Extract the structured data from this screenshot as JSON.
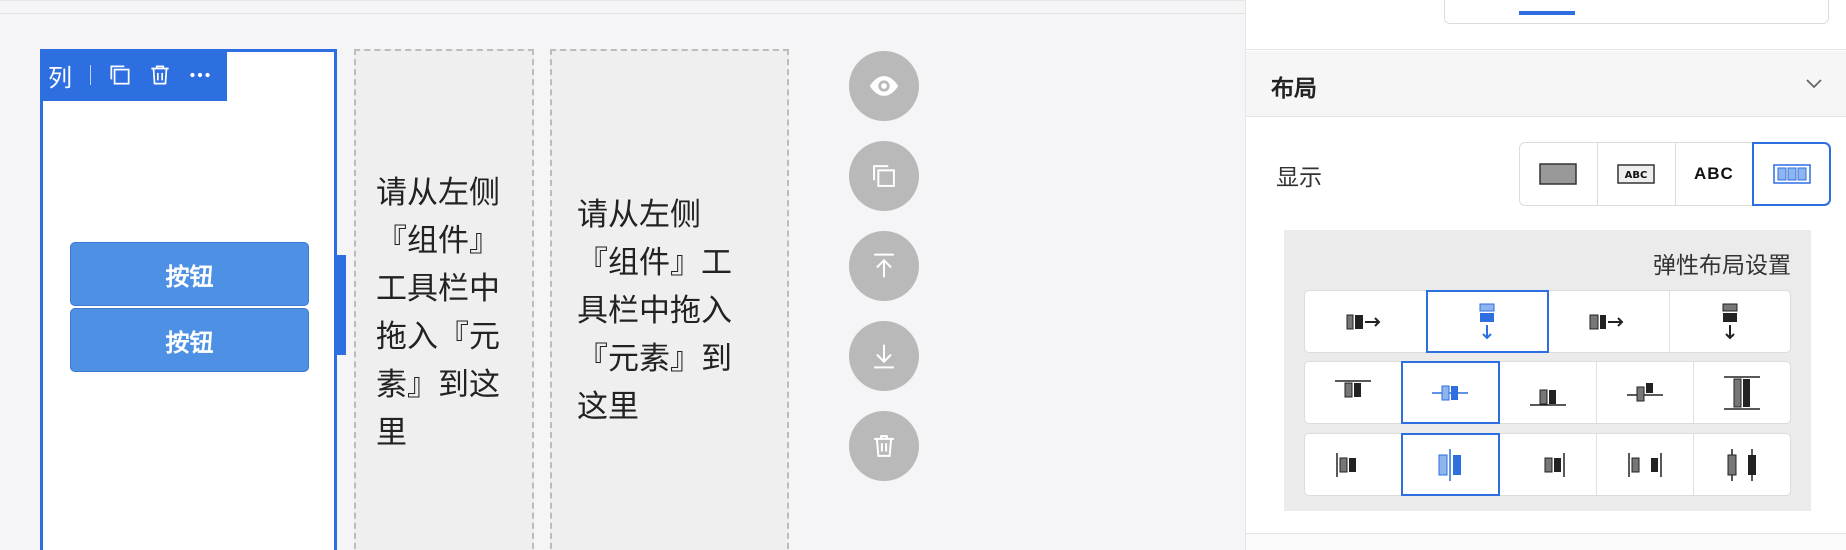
{
  "canvas": {
    "column_toolbar": {
      "label": "列",
      "icons": [
        "copy-icon",
        "trash-icon",
        "more-icon"
      ]
    },
    "buttons": [
      "按钮",
      "按钮"
    ],
    "placeholder_col2": "请从左侧『组件』工具栏中拖入『元素』到这里",
    "placeholder_col3": "请从左侧『组件』工具栏中拖入『元素』到这里",
    "fab_actions": [
      "eye-icon",
      "copy-icon",
      "move-up-icon",
      "move-down-icon",
      "trash-icon"
    ]
  },
  "panel": {
    "section_title": "布局",
    "display_label": "显示",
    "display_options": [
      "block",
      "inline-block",
      "inline",
      "flex"
    ],
    "display_inline_text": "ABC",
    "display_selected": "flex",
    "flex_title": "弹性布局设置",
    "flex_direction_selected": 1,
    "justify_selected": 1,
    "align_selected": 1
  },
  "colors": {
    "accent": "#2d6ee0",
    "button": "#4e90e3",
    "fab": "#b9b9b9"
  }
}
